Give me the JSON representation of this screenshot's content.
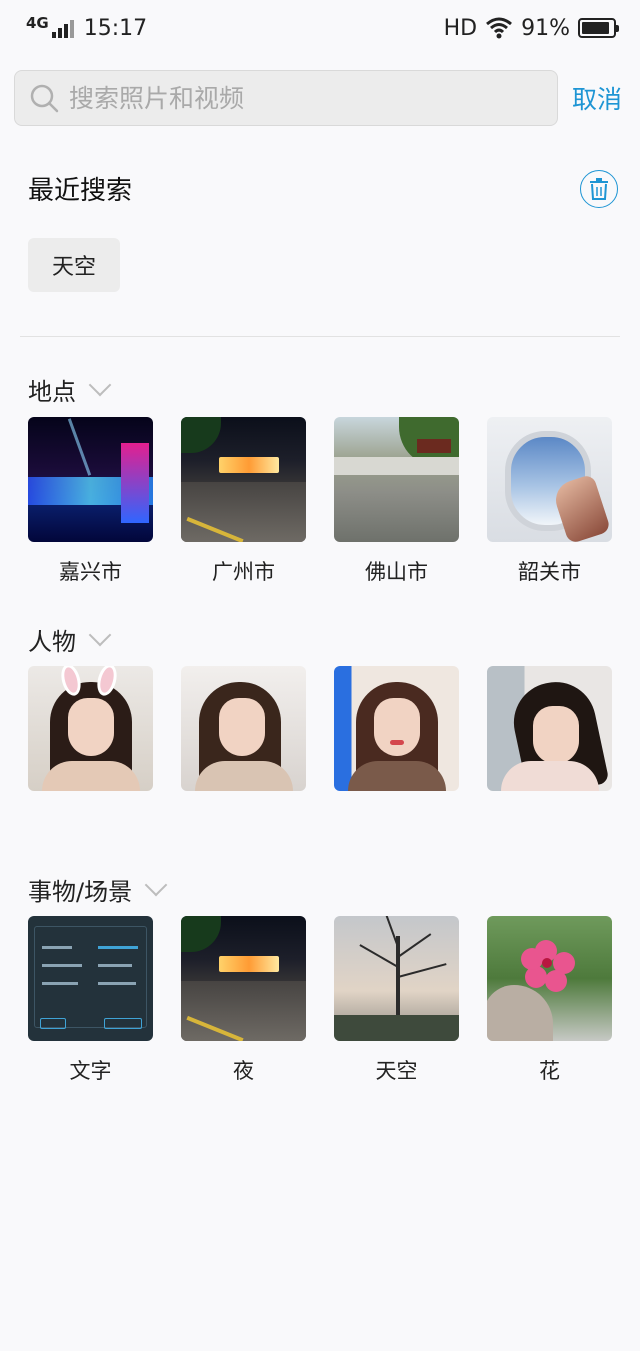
{
  "status_bar": {
    "network": "4G",
    "time": "15:17",
    "hd": "HD",
    "battery": "91%",
    "battery_level": 0.91
  },
  "search": {
    "placeholder": "搜索照片和视频",
    "value": "",
    "cancel_label": "取消"
  },
  "recent": {
    "title": "最近搜索",
    "items": [
      "天空"
    ]
  },
  "sections": {
    "places": {
      "title": "地点",
      "items": [
        "嘉兴市",
        "广州市",
        "佛山市",
        "韶关市"
      ]
    },
    "people": {
      "title": "人物"
    },
    "things": {
      "title": "事物/场景",
      "items": [
        "文字",
        "夜",
        "天空",
        "花"
      ]
    }
  },
  "colors": {
    "accent": "#1e95d4",
    "background": "#f9f9fb",
    "chip": "#ececec"
  }
}
